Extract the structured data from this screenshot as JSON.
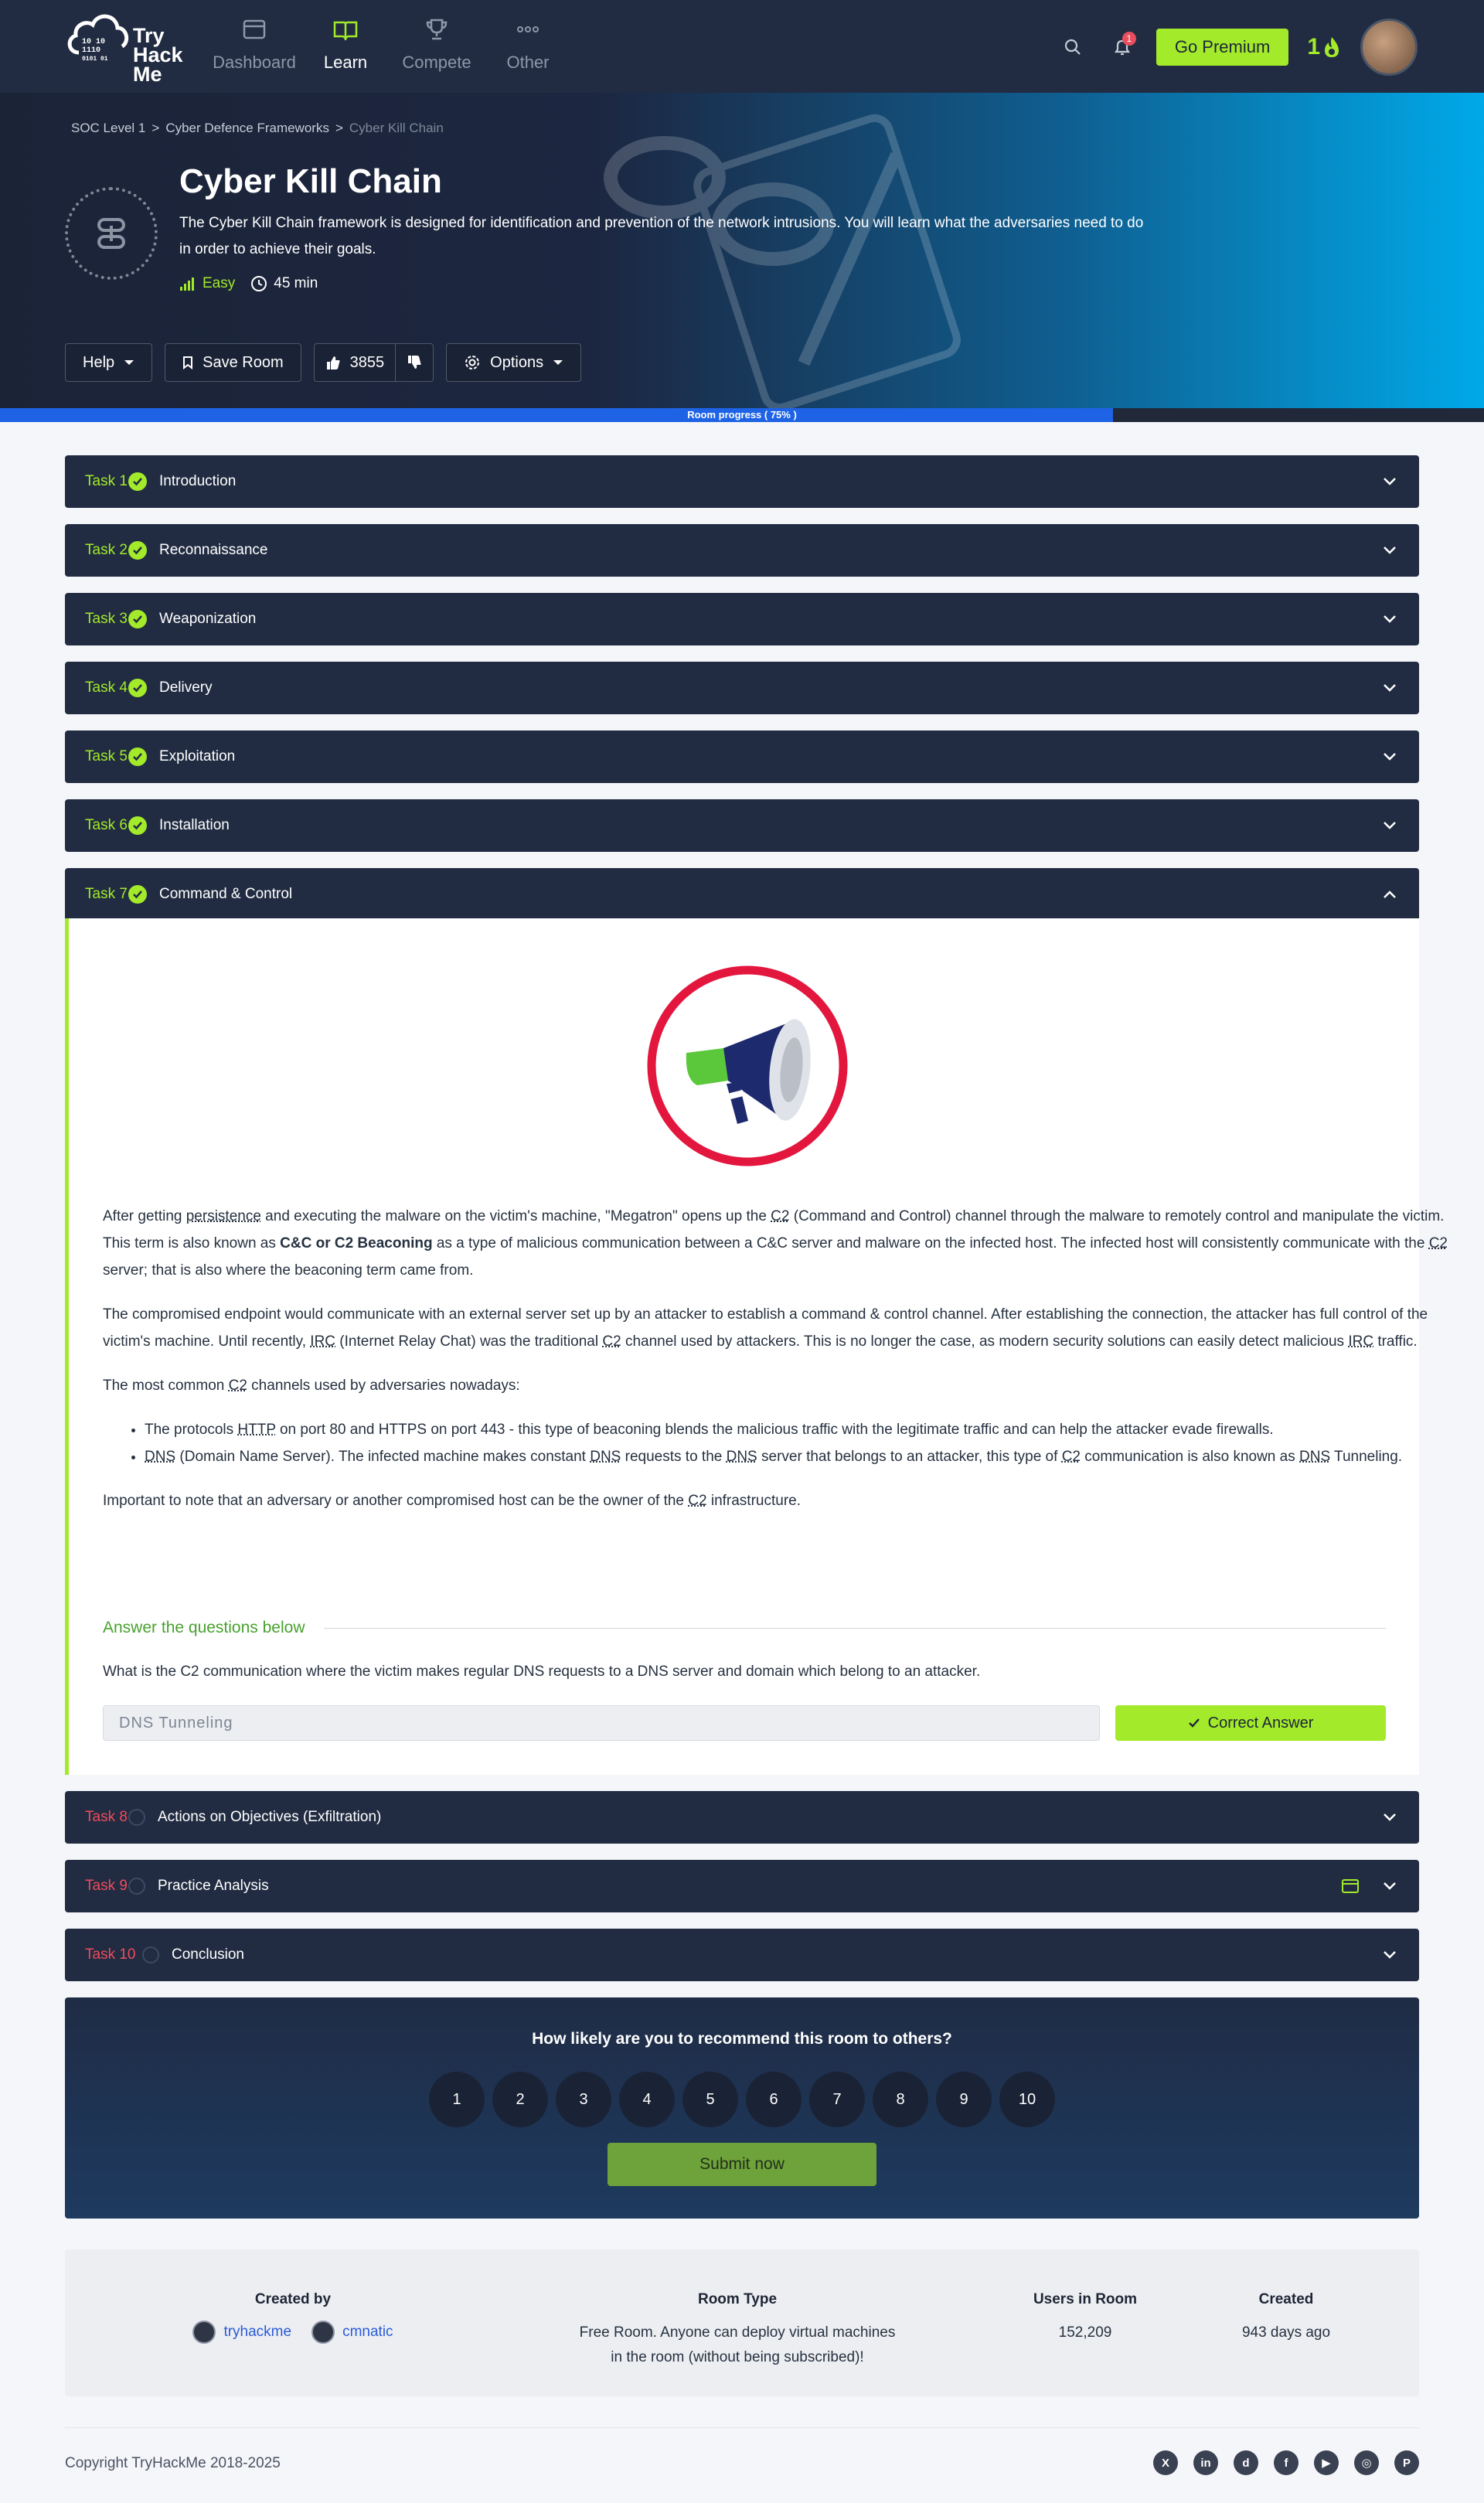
{
  "nav": {
    "logo_lines": [
      "Try",
      "Hack",
      "Me"
    ],
    "items": [
      {
        "label": "Dashboard",
        "icon": "dashboard-icon"
      },
      {
        "label": "Learn",
        "icon": "book-icon"
      },
      {
        "label": "Compete",
        "icon": "trophy-icon"
      },
      {
        "label": "Other",
        "icon": "more-icon"
      }
    ],
    "active": "Learn",
    "notifications": "1",
    "premium_label": "Go Premium",
    "streak": "1"
  },
  "hero": {
    "breadcrumb": [
      "SOC Level 1",
      ">",
      "Cyber Defence Frameworks",
      ">",
      "Cyber Kill Chain"
    ],
    "title": "Cyber Kill Chain",
    "description": "The Cyber Kill Chain framework is designed for identification and prevention of the network intrusions. You will learn what the adversaries need to do in order to achieve their goals.",
    "difficulty": "Easy",
    "duration": "45 min",
    "buttons": {
      "help": "Help",
      "save": "Save Room",
      "likes": "3855",
      "options": "Options"
    }
  },
  "progress": {
    "label": "Room progress ( 75% )",
    "percent": 75
  },
  "tasks": [
    {
      "num": "Task 1",
      "title": "Introduction",
      "done": true
    },
    {
      "num": "Task 2",
      "title": "Reconnaissance",
      "done": true
    },
    {
      "num": "Task 3",
      "title": "Weaponization",
      "done": true
    },
    {
      "num": "Task 4",
      "title": "Delivery",
      "done": true
    },
    {
      "num": "Task 5",
      "title": "Exploitation",
      "done": true
    },
    {
      "num": "Task 6",
      "title": "Installation",
      "done": true
    },
    {
      "num": "Task 7",
      "title": "Command & Control",
      "done": true
    },
    {
      "num": "Task 8",
      "title": "Actions on Objectives (Exfiltration)",
      "done": false
    },
    {
      "num": "Task 9",
      "title": "Practice Analysis",
      "done": false
    },
    {
      "num": "Task 10",
      "title": "Conclusion",
      "done": false
    }
  ],
  "task7": {
    "p1": [
      "After getting ",
      "persistence",
      " and executing the malware on the victim's machine, \"Megatron\" opens up the ",
      "C2",
      " (Command and Control) channel through the malware to remotely control and manipulate the victim. This term is also known as ",
      "C&C or C2 Beaconing",
      " as a type of malicious communication between a C&C server and malware on the infected host. The infected host will consistently communicate with the ",
      "C2",
      " server; that is also where the beaconing term came from."
    ],
    "p2": [
      "The compromised endpoint would communicate with an external server set up by an attacker to establish a command & control channel. After establishing the connection,  the attacker has full control of the victim's machine. Until recently, ",
      "IRC",
      " (Internet Relay Chat) was the traditional ",
      "C2",
      " channel used by attackers. This is no longer the case, as modern security solutions can easily detect malicious ",
      "IRC",
      " traffic."
    ],
    "p3": [
      "The most common ",
      "C2",
      " channels used by adversaries nowadays:"
    ],
    "li1": [
      "The protocols ",
      "HTTP",
      " on port 80 and HTTPS on port 443 - this type of beaconing blends the malicious traffic with the legitimate traffic and can help the attacker evade firewalls."
    ],
    "li2": [
      "DNS",
      " (Domain Name Server). The infected machine makes constant ",
      "DNS",
      " requests to the ",
      "DNS",
      " server that belongs to an attacker, this type of ",
      "C2",
      " communication is also known as ",
      "DNS",
      " Tunneling."
    ],
    "p4": [
      "Important to note that an adversary or another compromised host can be the owner of the ",
      "C2",
      " infrastructure."
    ],
    "answer_heading": "Answer the questions below",
    "question": "What is the C2 communication where the victim makes regular DNS requests to a DNS server and domain which belong to an attacker.",
    "answer_value": "DNS Tunneling",
    "answer_button": "Correct Answer"
  },
  "rating": {
    "question": "How likely are you to recommend this room to others?",
    "options": [
      "1",
      "2",
      "3",
      "4",
      "5",
      "6",
      "7",
      "8",
      "9",
      "10"
    ],
    "submit": "Submit now"
  },
  "info": {
    "created_by_label": "Created by",
    "creators": [
      "tryhackme",
      "cmnatic"
    ],
    "room_type_label": "Room Type",
    "room_type_lines": [
      "Free Room. Anyone can deploy virtual machines",
      "in the room (without being subscribed)!"
    ],
    "users_label": "Users in Room",
    "users": "152,209",
    "created_label": "Created",
    "created": "943 days ago"
  },
  "footer": {
    "copyright": "Copyright TryHackMe 2018-2025",
    "socials": [
      {
        "icon": "x-icon",
        "glyph": "X"
      },
      {
        "icon": "linkedin-icon",
        "glyph": "in"
      },
      {
        "icon": "discord-icon",
        "glyph": "d"
      },
      {
        "icon": "facebook-icon",
        "glyph": "f"
      },
      {
        "icon": "youtube-icon",
        "glyph": "▶"
      },
      {
        "icon": "instagram-icon",
        "glyph": "◎"
      },
      {
        "icon": "pinterest-icon",
        "glyph": "P"
      }
    ]
  },
  "colors": {
    "accent": "#a3ea2a",
    "nav_bg": "#212c42",
    "todo": "#ef4b5c",
    "progress": "#1e63e6"
  }
}
